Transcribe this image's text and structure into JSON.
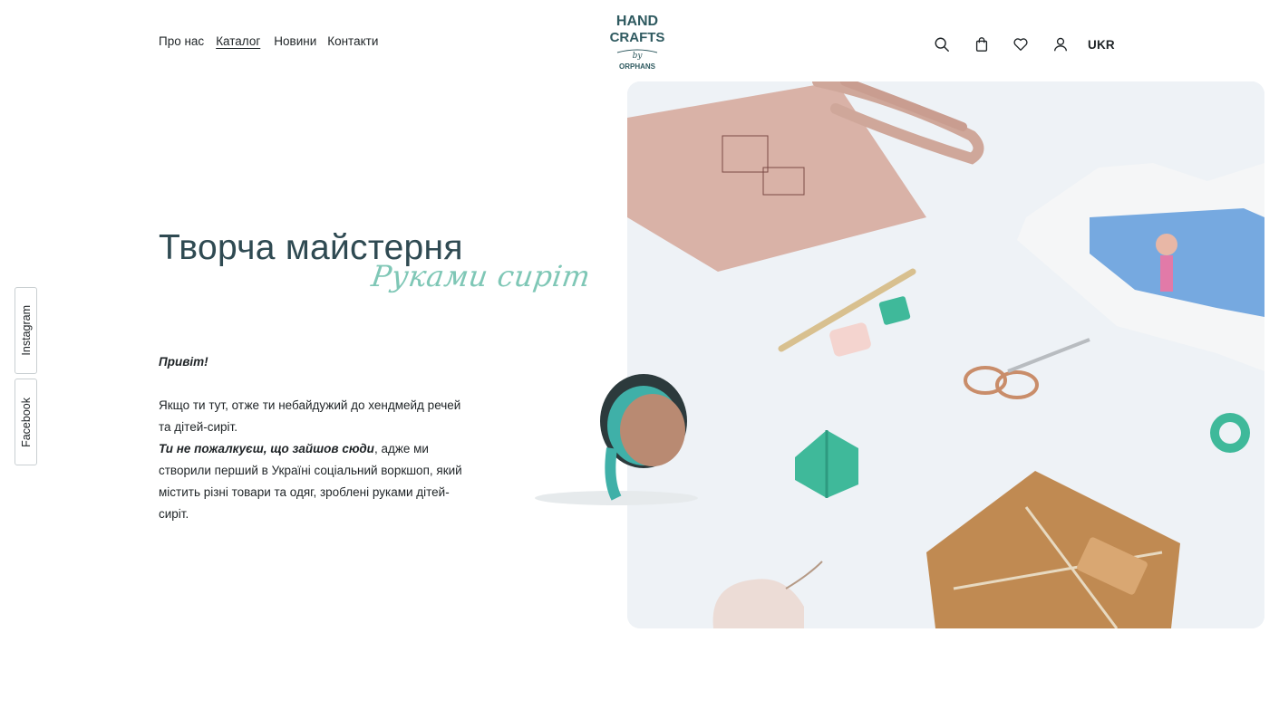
{
  "header": {
    "nav": [
      {
        "label": "Про нас"
      },
      {
        "label": "Каталог"
      },
      {
        "label": "Новини"
      },
      {
        "label": "Контакти"
      }
    ],
    "logo": {
      "line1": "HAND",
      "line2": "CRAFTS",
      "line3": "by",
      "line4": "ORPHANS"
    },
    "actions": [
      "search-icon",
      "bag-icon",
      "heart-icon",
      "user-icon"
    ],
    "language": "UKR"
  },
  "hero": {
    "title": "Творча майстерня",
    "subtitle": "Руками сиріт",
    "greeting": "Привіт!",
    "paragraph1": "Якщо ти тут, отже ти небайдужий до хендмейд речей та дітей-сиріт.",
    "emphasis": "Ти не пожалкуєш, що зайшов сюди",
    "paragraph2": ", адже ми створили перший в Україні соціальний воркшоп, який містить різні товари та одяг, зроблені руками дітей-сиріт."
  },
  "social": {
    "instagram": "Instagram",
    "facebook": "Facebook"
  },
  "colors": {
    "accent": "#7fc7b6",
    "title": "#2f4a52",
    "text": "#1e2326",
    "image_bg": "#eef2f6"
  }
}
